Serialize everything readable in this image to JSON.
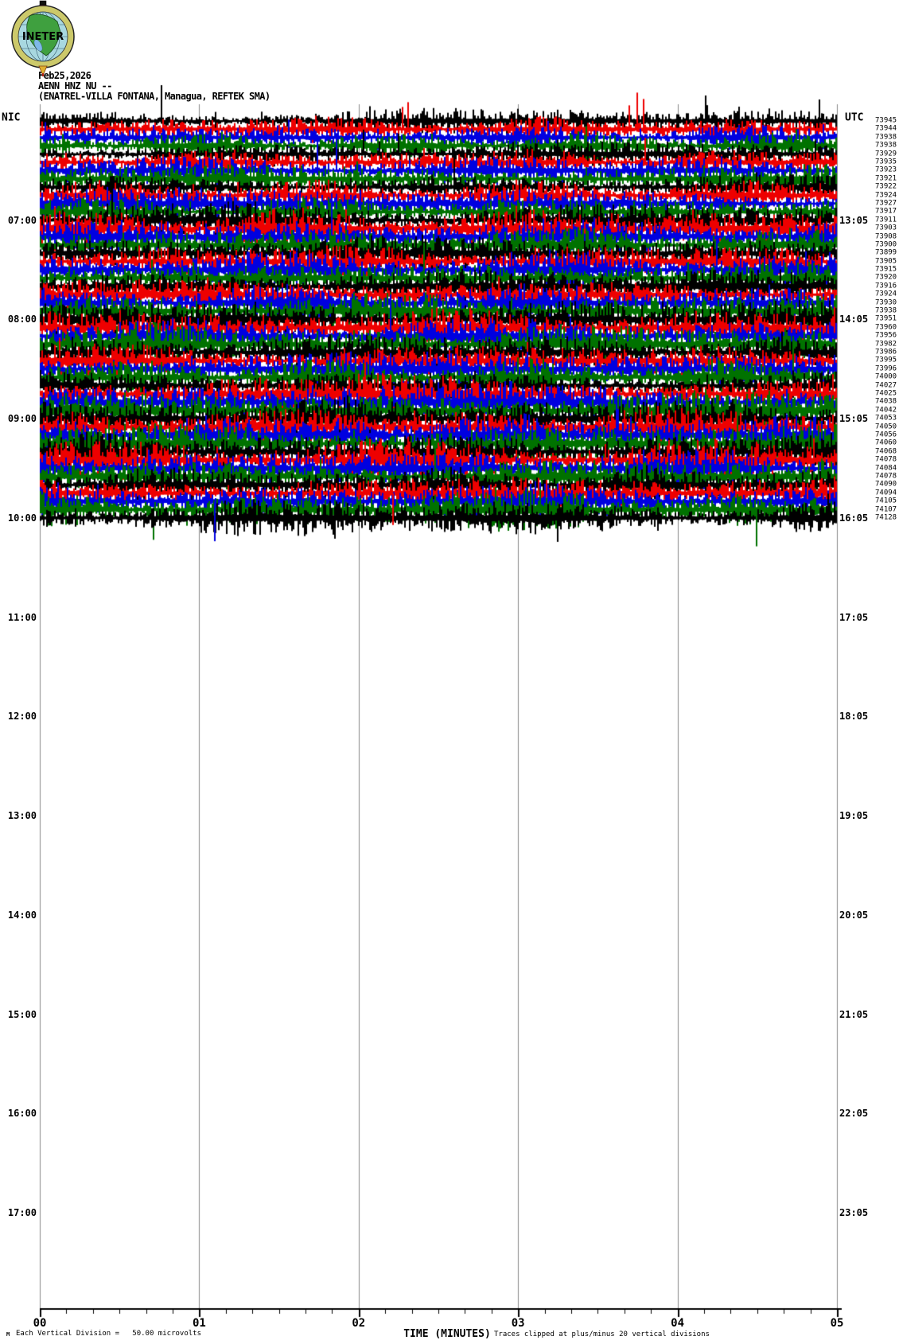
{
  "header": {
    "date": "Feb25,2026",
    "station": "AENN HNZ NU --",
    "station_info": "(ENATREL-VILLA FONTANA, Managua, REFTEK SMA)",
    "logo_text": "INETER"
  },
  "axes": {
    "left_corner_label": "NIC",
    "right_corner_label": "UTC",
    "left_hour_labels": [
      "07:00",
      "08:00",
      "09:00",
      "10:00",
      "11:00",
      "12:00",
      "13:00",
      "14:00",
      "15:00",
      "16:00",
      "17:00"
    ],
    "right_hour_labels": [
      "13:05",
      "14:05",
      "15:05",
      "16:05",
      "17:05",
      "18:05",
      "19:05",
      "20:05",
      "21:05",
      "22:05",
      "23:05"
    ],
    "x_tick_labels": [
      "00",
      "01",
      "02",
      "03",
      "04",
      "05"
    ],
    "x_axis_title": "TIME (MINUTES)"
  },
  "footer": {
    "corner_mark": "M",
    "scale_note": "Each Vertical Division =   50.00 microvolts",
    "clip_note": "Traces clipped at plus/minus 20 vertical divisions"
  },
  "chart_data": {
    "type": "line",
    "subtype": "helicorder_seismogram",
    "title": "AENN HNZ NU -- (ENATREL-VILLA FONTANA, Managua, REFTEK SMA)",
    "date": "Feb25,2026",
    "xlabel": "TIME (MINUTES)",
    "x_ticks": [
      "00",
      "01",
      "02",
      "03",
      "04",
      "05"
    ],
    "x_minor_divisions_per_major": 6,
    "minutes_per_row": 5,
    "rows_with_data": 49,
    "rows_per_hour": 12,
    "left_time_ticks": [
      "07:00",
      "08:00",
      "09:00",
      "10:00",
      "11:00",
      "12:00",
      "13:00",
      "14:00",
      "15:00",
      "16:00",
      "17:00"
    ],
    "right_time_ticks": [
      "13:05",
      "14:05",
      "15:05",
      "16:05",
      "17:05",
      "18:05",
      "19:05",
      "20:05",
      "21:05",
      "22:05",
      "23:05"
    ],
    "trace_color_cycle": [
      "#000000",
      "#ee0000",
      "#0000e0",
      "#007200"
    ],
    "grid_color": "#8a8a8a",
    "vertical_division_microvolts": 50.0,
    "clip_divisions": 20,
    "row_baseline_values": [
      73945,
      73944,
      73938,
      73938,
      73929,
      73935,
      73923,
      73921,
      73922,
      73924,
      73927,
      73917,
      73911,
      73903,
      73908,
      73900,
      73899,
      73905,
      73915,
      73920,
      73916,
      73924,
      73930,
      73938,
      73951,
      73960,
      73956,
      73982,
      73986,
      73995,
      73996,
      74000,
      74027,
      74025,
      74038,
      74042,
      74053,
      74050,
      74056,
      74060,
      74068,
      74078,
      74084,
      74078,
      74090,
      74094,
      74105,
      74107,
      74128
    ]
  }
}
